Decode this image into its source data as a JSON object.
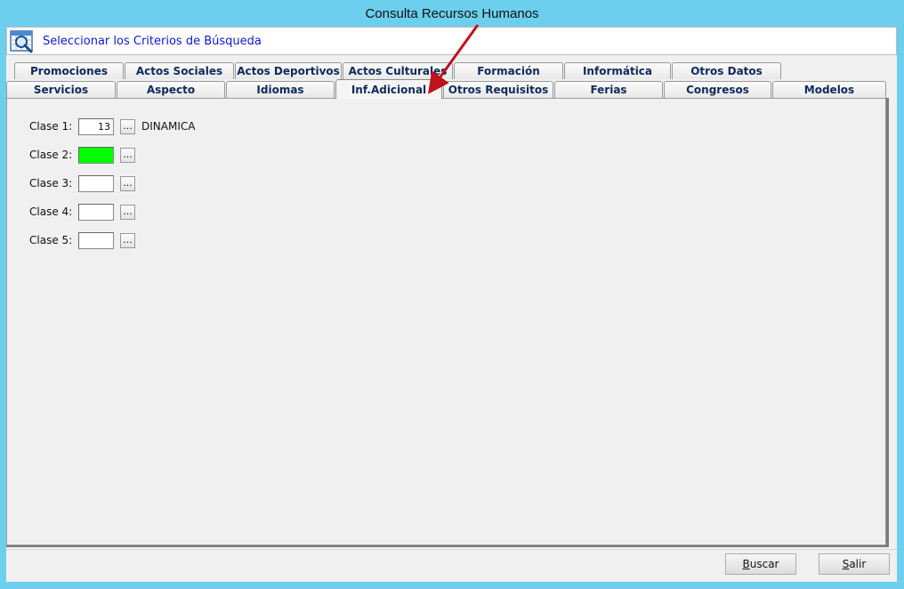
{
  "window": {
    "title": "Consulta Recursos Humanos"
  },
  "header": {
    "title": "Seleccionar los Criterios de Búsqueda",
    "icon": "search-calendar-icon"
  },
  "tabs_back": [
    "Promociones",
    "Actos Sociales",
    "Actos Deportivos",
    "Actos Culturales",
    "Formación",
    "Informática",
    "Otros Datos"
  ],
  "tabs_front": [
    "Servicios",
    "Aspecto",
    "Idiomas",
    "Inf.Adicional",
    "Otros Requisitos",
    "Ferias",
    "Congresos",
    "Modelos"
  ],
  "active_tab": "Inf.Adicional",
  "fields": [
    {
      "label": "Clase 1:",
      "value": "13",
      "description": "DINAMICA",
      "button": "..."
    },
    {
      "label": "Clase 2:",
      "value": "",
      "description": "",
      "button": "...",
      "highlight": "#00ff00"
    },
    {
      "label": "Clase 3:",
      "value": "",
      "description": "",
      "button": "..."
    },
    {
      "label": "Clase 4:",
      "value": "",
      "description": "",
      "button": "..."
    },
    {
      "label": "Clase 5:",
      "value": "",
      "description": "",
      "button": "..."
    }
  ],
  "buttons": {
    "search": {
      "label_first": "B",
      "label_rest": "uscar"
    },
    "exit": {
      "label_first": "S",
      "label_rest": "alir"
    }
  },
  "colors": {
    "titlebar": "#6ccfee",
    "header_text": "#0a1ad0",
    "annotation_arrow": "#c0121a"
  }
}
